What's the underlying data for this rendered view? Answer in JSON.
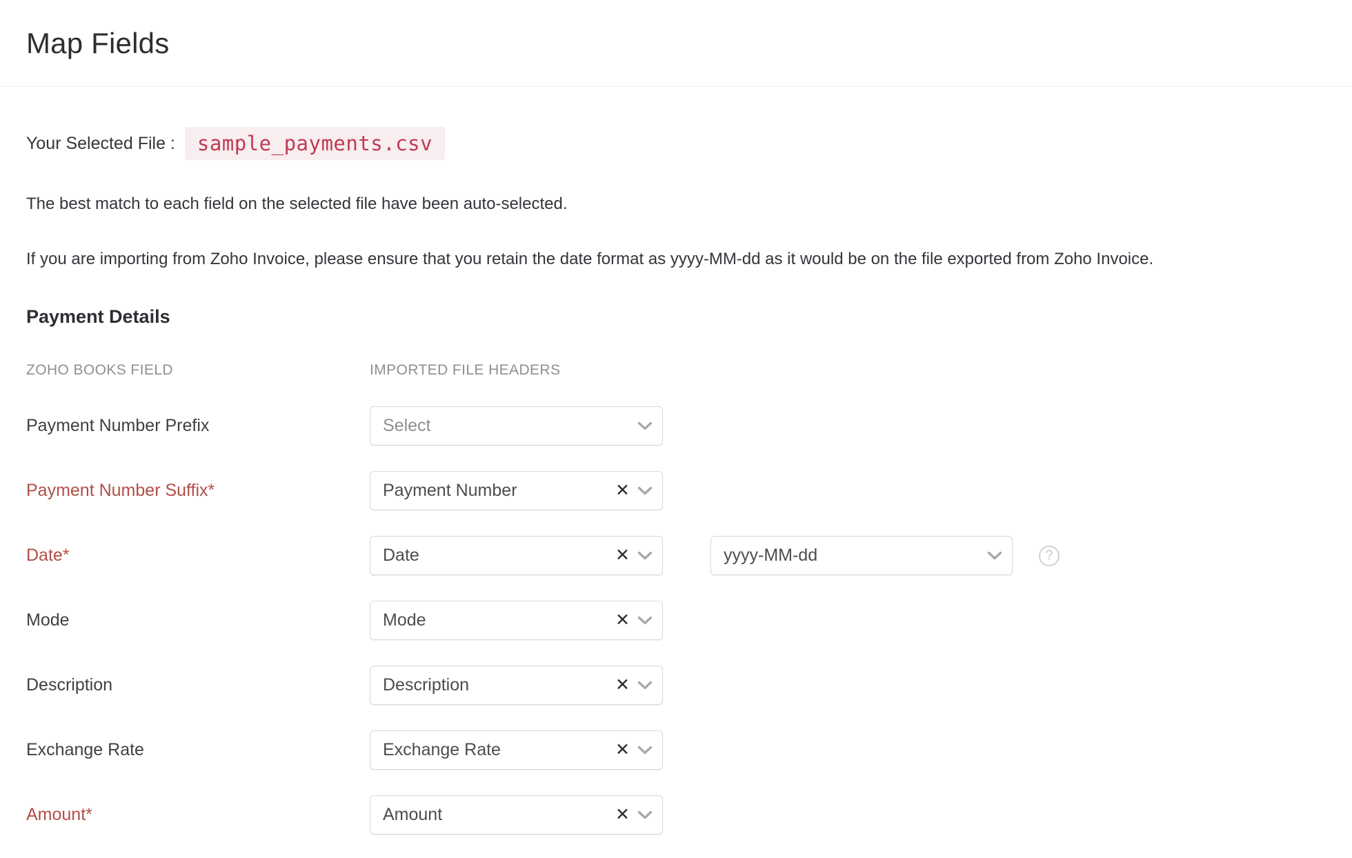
{
  "page": {
    "title": "Map Fields"
  },
  "file": {
    "label": "Your Selected File :",
    "filename": "sample_payments.csv"
  },
  "notes": {
    "auto_select": "The best match to each field on the selected file have been auto-selected.",
    "date_format": "If you are importing from Zoho Invoice, please ensure that you retain the date format as yyyy-MM-dd as it would be on the file exported from Zoho Invoice."
  },
  "section": {
    "title": "Payment Details",
    "columns": {
      "left": "ZOHO BOOKS FIELD",
      "right": "IMPORTED FILE HEADERS"
    }
  },
  "rows": [
    {
      "label": "Payment Number Prefix",
      "required": false,
      "value": "Select",
      "placeholder": true,
      "clearable": false
    },
    {
      "label": "Payment Number Suffix*",
      "required": true,
      "value": "Payment Number",
      "placeholder": false,
      "clearable": true
    },
    {
      "label": "Date*",
      "required": true,
      "value": "Date",
      "placeholder": false,
      "clearable": true,
      "format": "yyyy-MM-dd",
      "help": true
    },
    {
      "label": "Mode",
      "required": false,
      "value": "Mode",
      "placeholder": false,
      "clearable": true
    },
    {
      "label": "Description",
      "required": false,
      "value": "Description",
      "placeholder": false,
      "clearable": true
    },
    {
      "label": "Exchange Rate",
      "required": false,
      "value": "Exchange Rate",
      "placeholder": false,
      "clearable": true
    },
    {
      "label": "Amount*",
      "required": true,
      "value": "Amount",
      "placeholder": false,
      "clearable": true
    }
  ],
  "icons": {
    "clear": "✕",
    "chevron_down": "chevron-down",
    "help": "?"
  },
  "colors": {
    "required_label": "#b24f48",
    "filename_text": "#bf3a53",
    "filename_bg": "#f8edef",
    "placeholder_text": "#8f8f92",
    "box_border": "#d8d8d8",
    "column_header": "#8f8f92"
  }
}
